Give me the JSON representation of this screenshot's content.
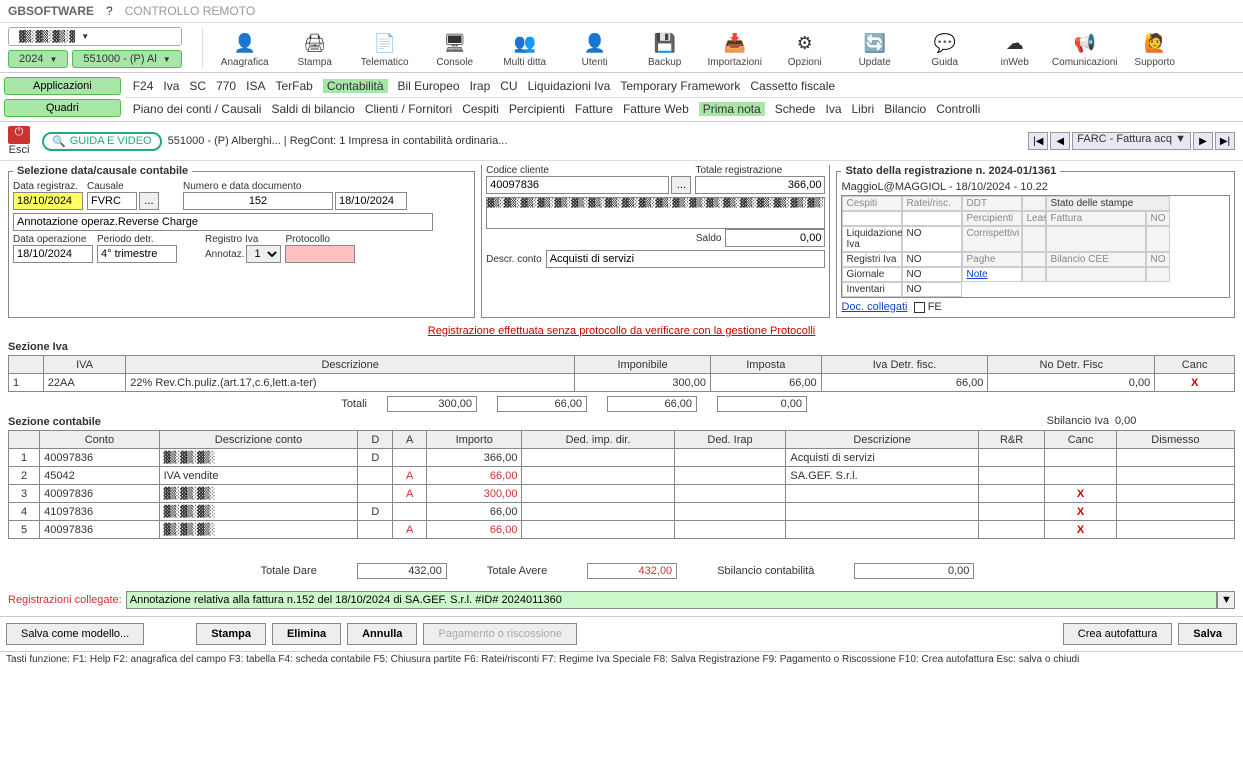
{
  "top": {
    "brand": "GBSOFTWARE",
    "help": "?",
    "remote": "CONTROLLO REMOTO"
  },
  "selectors": {
    "noise": "▓▒░▓▒░▓▒░▓",
    "year": "2024",
    "company": "551000 - (P) Al"
  },
  "ribbon": [
    {
      "icon": "👤",
      "label": "Anagrafica"
    },
    {
      "icon": "🖨",
      "label": "Stampa"
    },
    {
      "icon": "📄",
      "label": "Telematico"
    },
    {
      "icon": "🖥",
      "label": "Console"
    },
    {
      "icon": "👥",
      "label": "Multi ditta"
    },
    {
      "icon": "👤",
      "label": "Utenti"
    },
    {
      "icon": "💾",
      "label": "Backup"
    },
    {
      "icon": "📥",
      "label": "Importazioni"
    },
    {
      "icon": "⚙",
      "label": "Opzioni"
    },
    {
      "icon": "🔄",
      "label": "Update"
    },
    {
      "icon": "💬",
      "label": "Guida"
    },
    {
      "icon": "☁",
      "label": "inWeb"
    },
    {
      "icon": "📢",
      "label": "Comunicazioni"
    },
    {
      "icon": "🙋",
      "label": "Supporto"
    }
  ],
  "apps": {
    "applicazioni": "Applicazioni",
    "quadri": "Quadri"
  },
  "tabs1": [
    "F24",
    "Iva",
    "SC",
    "770",
    "ISA",
    "TerFab",
    "Contabilità",
    "Bil Europeo",
    "Irap",
    "CU",
    "Liquidazioni Iva",
    "Temporary Framework",
    "Cassetto fiscale"
  ],
  "tabs1_active": 6,
  "tabs2": [
    "Piano dei conti / Causali",
    "Saldi di bilancio",
    "Clienti / Fornitori",
    "Cespiti",
    "Percipienti",
    "Fatture",
    "Fatture Web",
    "Prima nota",
    "Schede",
    "Iva",
    "Libri",
    "Bilancio",
    "Controlli"
  ],
  "tabs2_active": 7,
  "esci": "Esci",
  "pill": "GUIDA E VIDEO",
  "context": "551000 - (P) Alberghi... | RegCont: 1 Impresa  in contabilità ordinaria...",
  "nav": {
    "type": "FARC - Fattura acq"
  },
  "sel": {
    "legend": "Selezione data/causale contabile",
    "lbl_data": "Data registraz.",
    "data": "18/10/2024",
    "lbl_caus": "Causale",
    "caus": "FVRC",
    "more": "...",
    "lbl_num": "Numero e data documento",
    "num": "152",
    "ddata": "18/10/2024",
    "annot": "Annotazione operaz.Reverse Charge",
    "lbl_dop": "Data operazione",
    "dop": "18/10/2024",
    "lbl_per": "Periodo detr.",
    "per": "4° trimestre",
    "lbl_reg": "Registro Iva",
    "lbl_ann": "Annotaz.",
    "ann": "1",
    "lbl_prot": "Protocollo",
    "lbl_cod": "Codice cliente",
    "cod": "40097836",
    "lbl_desc": "Descr. conto",
    "desc": "Acquisti di servizi",
    "lbl_tot": "Totale registrazione",
    "tot": "366,00",
    "lbl_saldo": "Saldo",
    "saldo": "0,00"
  },
  "reg": {
    "stato": "Stato della registrazione n. 2024-01/1361",
    "user": "MaggioL@MAGGIOL - 18/10/2024 - 10.22",
    "rows": [
      [
        "Cespiti",
        "Ratei/risc.",
        "DDT",
        "",
        "",
        ""
      ],
      [
        "Percipienti",
        "Leasing",
        "Fattura",
        "NO",
        "Liquidazione Iva",
        "NO"
      ],
      [
        "Corrispettivi",
        "",
        "",
        "",
        "Registri Iva",
        "NO"
      ],
      [
        "Paghe",
        "",
        "Bilancio CEE",
        "NO",
        "Giornale",
        "NO"
      ],
      [
        "Note",
        "",
        "",
        "",
        "Inventari",
        "NO"
      ]
    ],
    "stampe": "Stato delle stampe",
    "doc": "Doc. collegati",
    "fe": "FE"
  },
  "warn": "Registrazione effettuata senza protocollo da verificare con la gestione Protocolli",
  "iva": {
    "title": "Sezione Iva",
    "head": [
      "",
      "IVA",
      "Descrizione",
      "Imponibile",
      "Imposta",
      "Iva Detr. fisc.",
      "No Detr. Fisc",
      "Canc"
    ],
    "rows": [
      [
        "1",
        "22AA",
        "22% Rev.Ch.puliz.(art.17,c.6,lett.a-ter)",
        "300,00",
        "66,00",
        "66,00",
        "0,00",
        "X"
      ]
    ],
    "tot_lbl": "Totali",
    "tot": [
      "300,00",
      "66,00",
      "66,00",
      "0,00"
    ]
  },
  "cont": {
    "title": "Sezione contabile",
    "sbil_lbl": "Sbilancio Iva",
    "sbil": "0,00",
    "head": [
      "",
      "Conto",
      "Descrizione conto",
      "D",
      "A",
      "Importo",
      "Ded. imp. dir.",
      "Ded. Irap",
      "Descrizione",
      "R&R",
      "Canc",
      "Dismesso"
    ],
    "rows": [
      {
        "n": "1",
        "conto": "40097836",
        "desc": "▓▒░▓▒░▓▒░",
        "d": "D",
        "a": "",
        "imp": "366,00",
        "ddd": "",
        "irap": "",
        "rdsc": "Acquisti di servizi",
        "canc": "",
        "red": false
      },
      {
        "n": "2",
        "conto": "45042",
        "desc": "IVA vendite",
        "d": "",
        "a": "A",
        "imp": "66,00",
        "ddd": "",
        "irap": "",
        "rdsc": "SA.GEF. S.r.l.",
        "canc": "",
        "red": true
      },
      {
        "n": "3",
        "conto": "40097836",
        "desc": "▓▒░▓▒░▓▒░",
        "d": "",
        "a": "A",
        "imp": "300,00",
        "ddd": "",
        "irap": "",
        "rdsc": "",
        "canc": "X",
        "red": true
      },
      {
        "n": "4",
        "conto": "41097836",
        "desc": "▓▒░▓▒░▓▒░",
        "d": "D",
        "a": "",
        "imp": "66,00",
        "ddd": "",
        "irap": "",
        "rdsc": "",
        "canc": "X",
        "red": false
      },
      {
        "n": "5",
        "conto": "40097836",
        "desc": "▓▒░▓▒░▓▒░",
        "d": "",
        "a": "A",
        "imp": "66,00",
        "ddd": "",
        "irap": "",
        "rdsc": "",
        "canc": "X",
        "red": true
      }
    ],
    "dare_lbl": "Totale Dare",
    "dare": "432,00",
    "avere_lbl": "Totale Avere",
    "avere": "432,00",
    "sbilc_lbl": "Sbilancio contabilità",
    "sbilc": "0,00"
  },
  "coll": {
    "lbl": "Registrazioni collegate:",
    "val": "Annotazione relativa alla fattura n.152 del 18/10/2024 di SA.GEF. S.r.l. #ID# 2024011360"
  },
  "foot": {
    "modello": "Salva come modello...",
    "stampa": "Stampa",
    "elimina": "Elimina",
    "annulla": "Annulla",
    "pag": "Pagamento o riscossione",
    "autof": "Crea autofattura",
    "salva": "Salva"
  },
  "status": "Tasti funzione:  F1: Help  F2: anagrafica del campo  F3: tabella  F4: scheda contabile F5: Chiusura partite  F6: Ratei/risconti  F7: Regime Iva Speciale F8: Salva Registrazione   F9: Pagamento o Riscossione F10: Crea autofattura   Esc: salva o chiudi"
}
